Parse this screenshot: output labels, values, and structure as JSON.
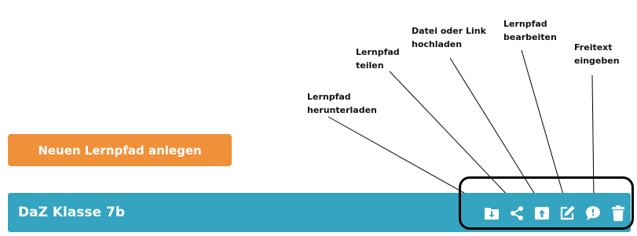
{
  "annotations": {
    "download": "Lernpfad\nherunterladen",
    "share": "Lernpfad\nteilen",
    "upload": "Datei oder Link\nhochladen",
    "edit": "Lernpfad\nbearbeiten",
    "freetext": "Freitext\neingeben"
  },
  "new_path_button": {
    "label": "Neuen Lernpfad anlegen"
  },
  "course": {
    "title": "DaZ Klasse 7b",
    "tools": [
      "download-icon",
      "share-icon",
      "upload-icon",
      "edit-icon",
      "comment-icon",
      "trash-icon"
    ]
  },
  "colors": {
    "button_orange": "#f0913a",
    "bar_teal": "#35a4c0"
  }
}
